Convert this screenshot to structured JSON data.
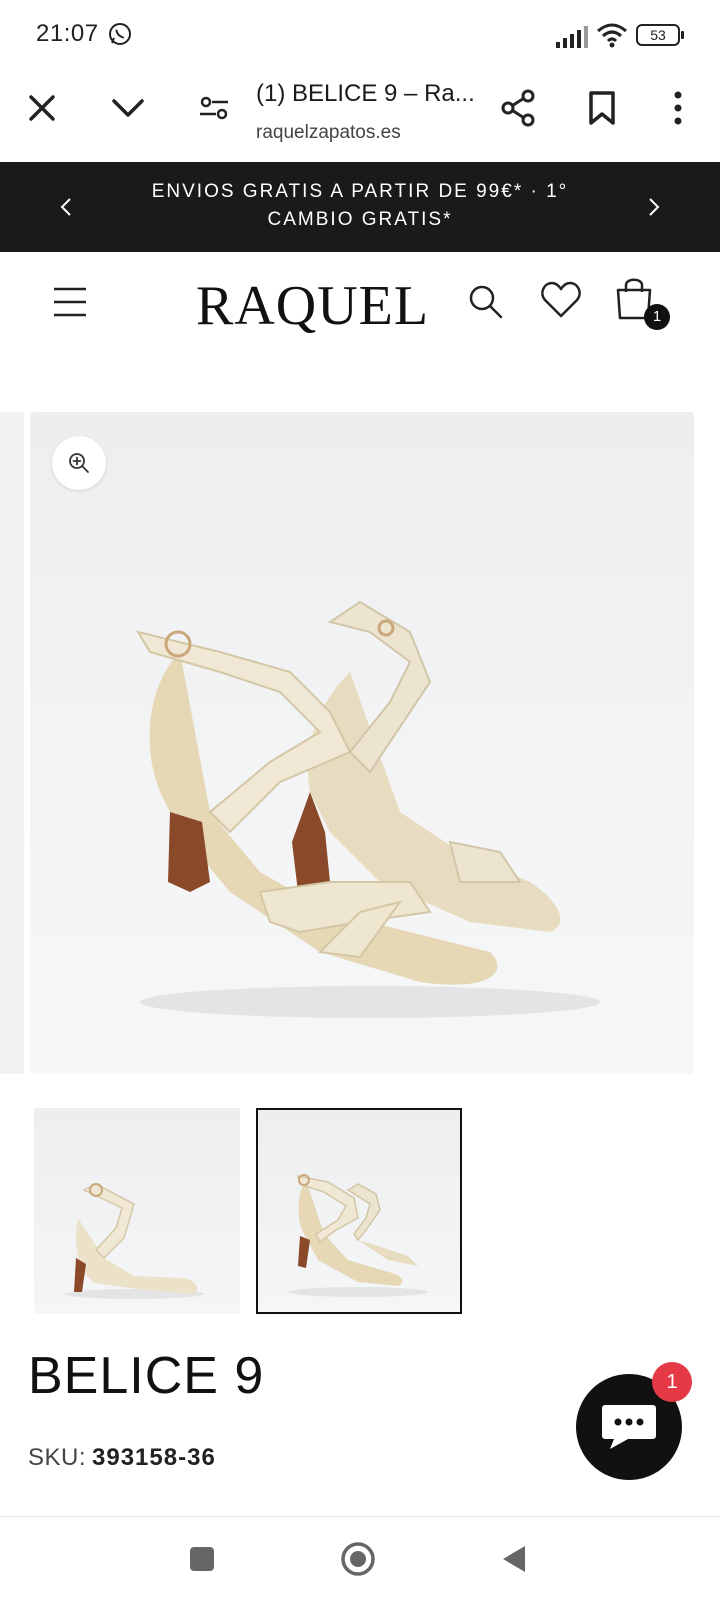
{
  "status_bar": {
    "time": "21:07",
    "battery": "53",
    "icons": [
      "whatsapp-icon",
      "signal-icon",
      "wifi-icon",
      "battery-icon"
    ]
  },
  "browser": {
    "tab_title": "(1) BELICE 9 – Ra...",
    "url": "raquelzapatos.es",
    "icons": [
      "close-icon",
      "chevron-down-icon",
      "page-info-icon",
      "share-icon",
      "bookmark-icon",
      "more-vert-icon"
    ]
  },
  "promo": {
    "text": "ENVIOS GRATIS A PARTIR DE 99€* · 1° CAMBIO GRATIS*"
  },
  "header": {
    "logo": "RAQUEL",
    "cart_count": "1"
  },
  "product": {
    "title": "BELICE 9",
    "sku_label": "SKU:",
    "sku_value": "393158-36"
  },
  "chat": {
    "badge": "1"
  },
  "colors": {
    "banner_bg": "#1a1a1a",
    "badge_red": "#e63946",
    "shoe_cream": "#ece4cf",
    "heel_brown": "#8a4a2a"
  }
}
